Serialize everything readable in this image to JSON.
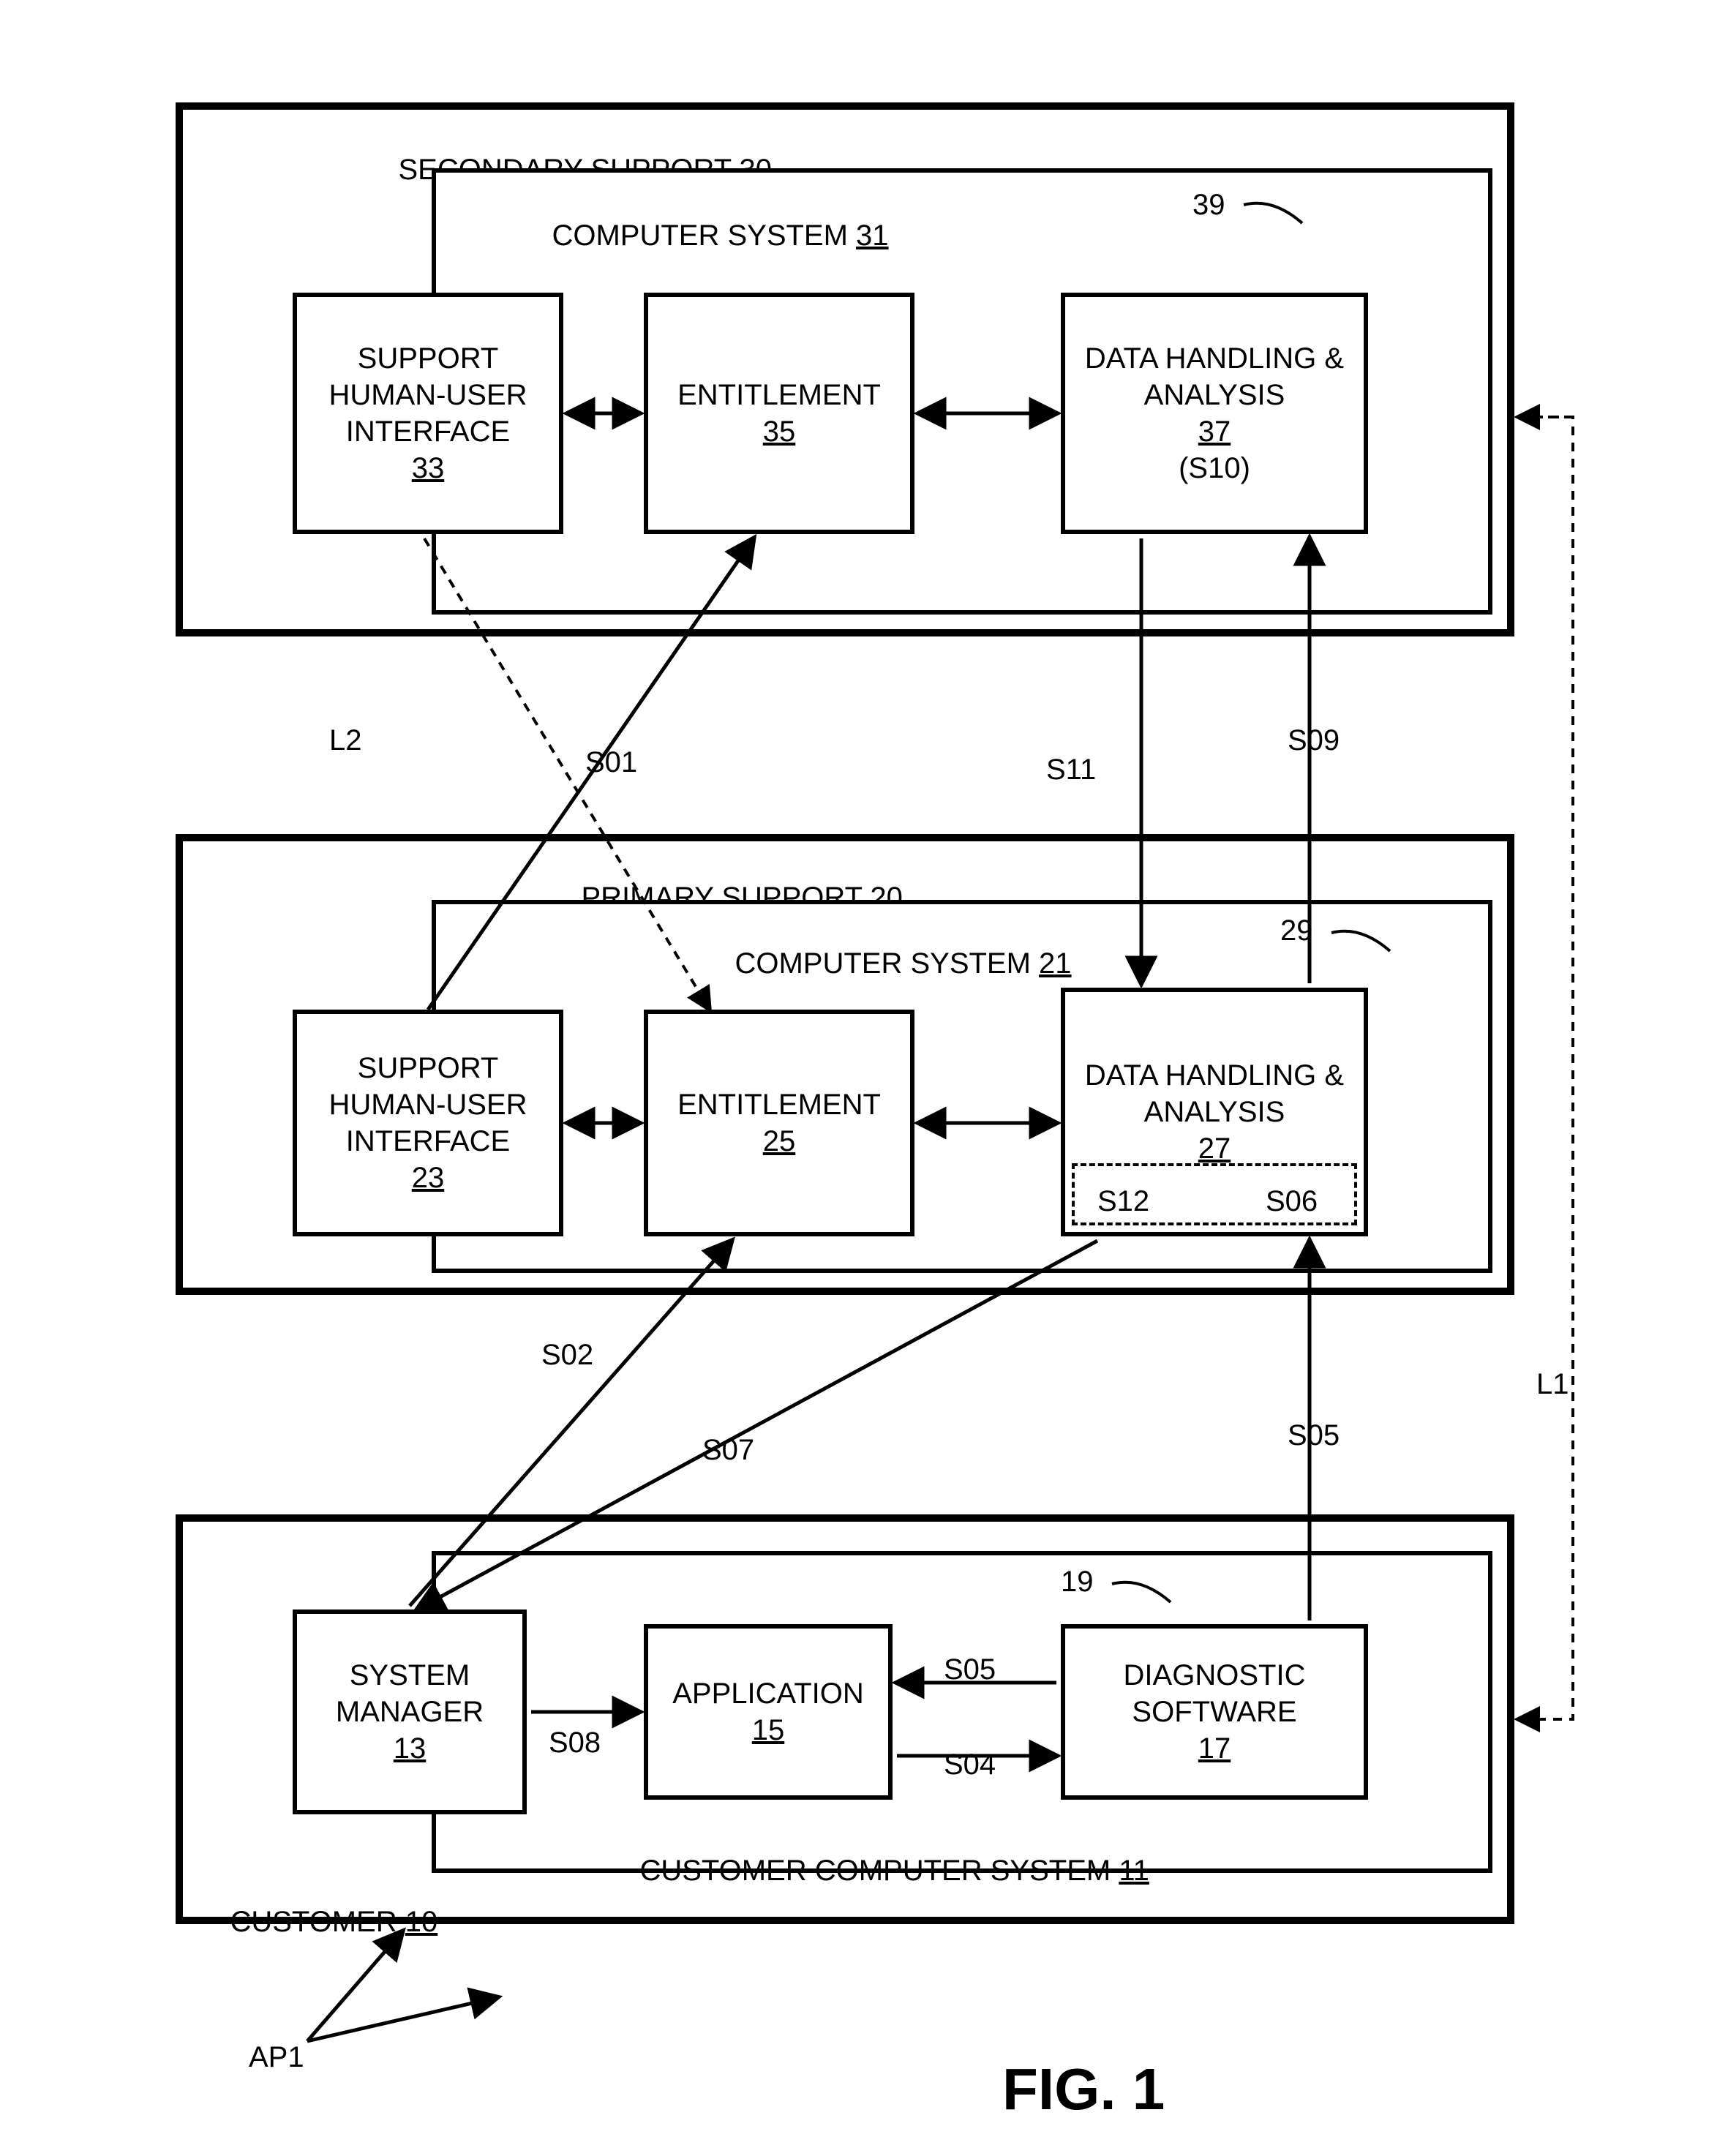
{
  "fig": "FIG. 1",
  "ap1": "AP1",
  "secondary": {
    "title_text": "SECONDARY SUPPORT ",
    "title_num": "30",
    "cs_text": "COMPUTER SYSTEM ",
    "cs_num": "31",
    "media_num": "39",
    "b1_t": "SUPPORT\nHUMAN-USER\nINTERFACE",
    "b1_n": "33",
    "b2_t": "ENTITLEMENT",
    "b2_n": "35",
    "b3_t": "DATA HANDLING\n& ANALYSIS",
    "b3_n": "37",
    "b3_s": "(S10)"
  },
  "primary": {
    "title_text": "PRIMARY SUPPORT ",
    "title_num": "20",
    "cs_text": "COMPUTER SYSTEM ",
    "cs_num": "21",
    "media_num": "29",
    "b1_t": "SUPPORT\nHUMAN-USER\nINTERFACE",
    "b1_n": "23",
    "b2_t": "ENTITLEMENT",
    "b2_n": "25",
    "b3_t": "DATA\nHANDLING &\nANALYSIS",
    "b3_n": "27",
    "b3_s12": "S12",
    "b3_s06": "S06"
  },
  "customer": {
    "title_text": "CUSTOMER ",
    "title_num": "10",
    "cs_text": "CUSTOMER COMPUTER SYSTEM ",
    "cs_num": "11",
    "media_num": "19",
    "b1_t": "SYSTEM\nMANAGER",
    "b1_n": "13",
    "b2_t": "APPLICATION",
    "b2_n": "15",
    "b3_t": "DIAGNOSTIC\nSOFTWARE",
    "b3_n": "17"
  },
  "edges": {
    "L1": "L1",
    "L2": "L2",
    "S01": "S01",
    "S02": "S02",
    "S04": "S04",
    "S05a": "S05",
    "S05b": "S05",
    "S07": "S07",
    "S08": "S08",
    "S09": "S09",
    "S11": "S11"
  }
}
